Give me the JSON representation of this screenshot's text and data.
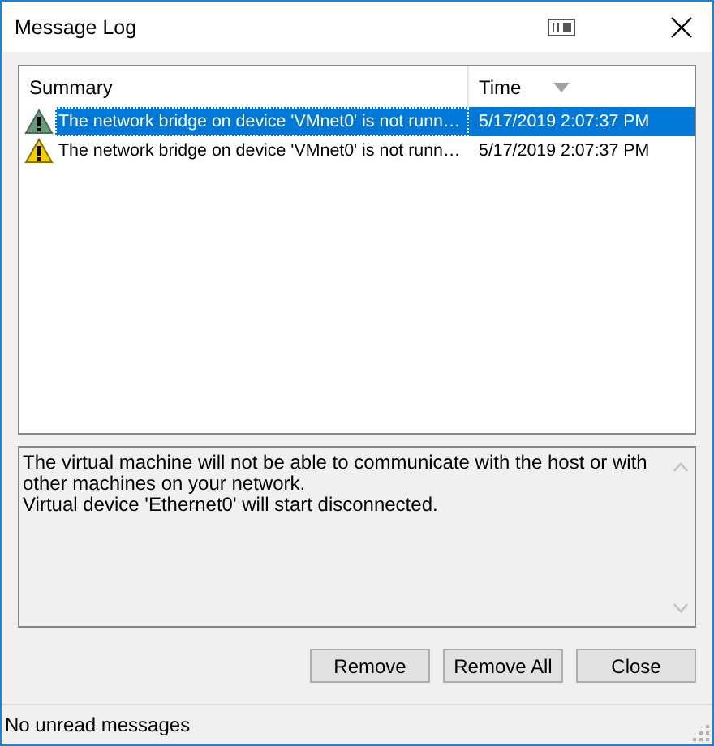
{
  "window": {
    "title": "Message Log"
  },
  "table": {
    "columns": [
      {
        "label": "Summary"
      },
      {
        "label": "Time",
        "sorted": true
      }
    ],
    "rows": [
      {
        "summary": "The network bridge on device 'VMnet0' is not runn…",
        "time": "5/17/2019 2:07:37 PM",
        "selected": true
      },
      {
        "summary": "The network bridge on device 'VMnet0' is not runn…",
        "time": "5/17/2019 2:07:37 PM",
        "selected": false
      }
    ]
  },
  "details": [
    "The virtual machine will not be able to communicate with the host or with other machines on your network.",
    "Virtual device 'Ethernet0' will start disconnected."
  ],
  "buttons": [
    "Remove",
    "Remove All",
    "Close"
  ],
  "status_bar": "No unread messages"
}
